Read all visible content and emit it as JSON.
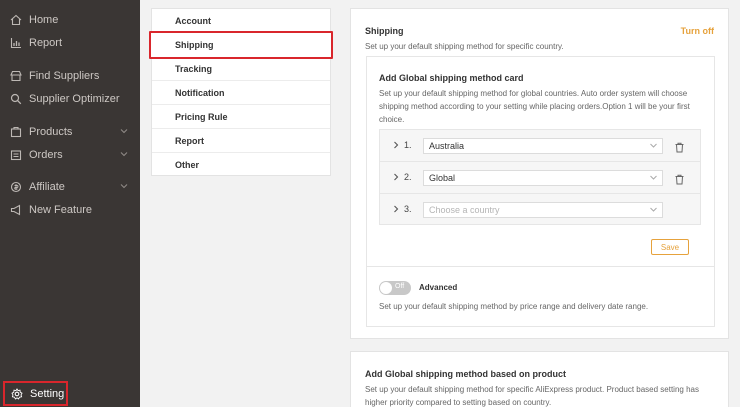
{
  "sidebar": {
    "items": [
      {
        "label": "Home",
        "icon": "home-icon"
      },
      {
        "label": "Report",
        "icon": "report-icon"
      },
      {
        "label": "Find Suppliers",
        "icon": "suppliers-icon"
      },
      {
        "label": "Supplier Optimizer",
        "icon": "search-icon"
      },
      {
        "label": "Products",
        "icon": "products-icon"
      },
      {
        "label": "Orders",
        "icon": "orders-icon"
      },
      {
        "label": "Affiliate",
        "icon": "affiliate-icon"
      },
      {
        "label": "New Feature",
        "icon": "megaphone-icon"
      }
    ],
    "setting_label": "Setting"
  },
  "menu": {
    "items": [
      "Account",
      "Shipping",
      "Tracking",
      "Notification",
      "Pricing Rule",
      "Report",
      "Other"
    ],
    "active": "Shipping"
  },
  "shipping": {
    "title": "Shipping",
    "turn_off": "Turn off",
    "desc": "Set up your default shipping method for specific country.",
    "global_card": {
      "title": "Add Global shipping method card",
      "desc": "Set up your default shipping method for global countries. Auto order system will choose shipping method according to your setting while placing orders.Option 1 will be your first choice.",
      "rows": [
        {
          "num": "1.",
          "value": "Australia"
        },
        {
          "num": "2.",
          "value": "Global"
        },
        {
          "num": "3.",
          "placeholder": "Choose a country"
        }
      ],
      "save_label": "Save"
    },
    "advanced": {
      "toggle_label": "Off",
      "title": "Advanced",
      "desc": "Set up your default shipping method by price range and delivery date range."
    }
  },
  "product_card": {
    "title": "Add Global shipping method based on product",
    "desc": "Set up your default shipping method for specific AliExpress product. Product based setting has higher priority compared to setting based on country."
  },
  "colors": {
    "sidebar_bg": "#3a3634",
    "accent": "#e6a23c",
    "highlight": "#d9262c"
  }
}
